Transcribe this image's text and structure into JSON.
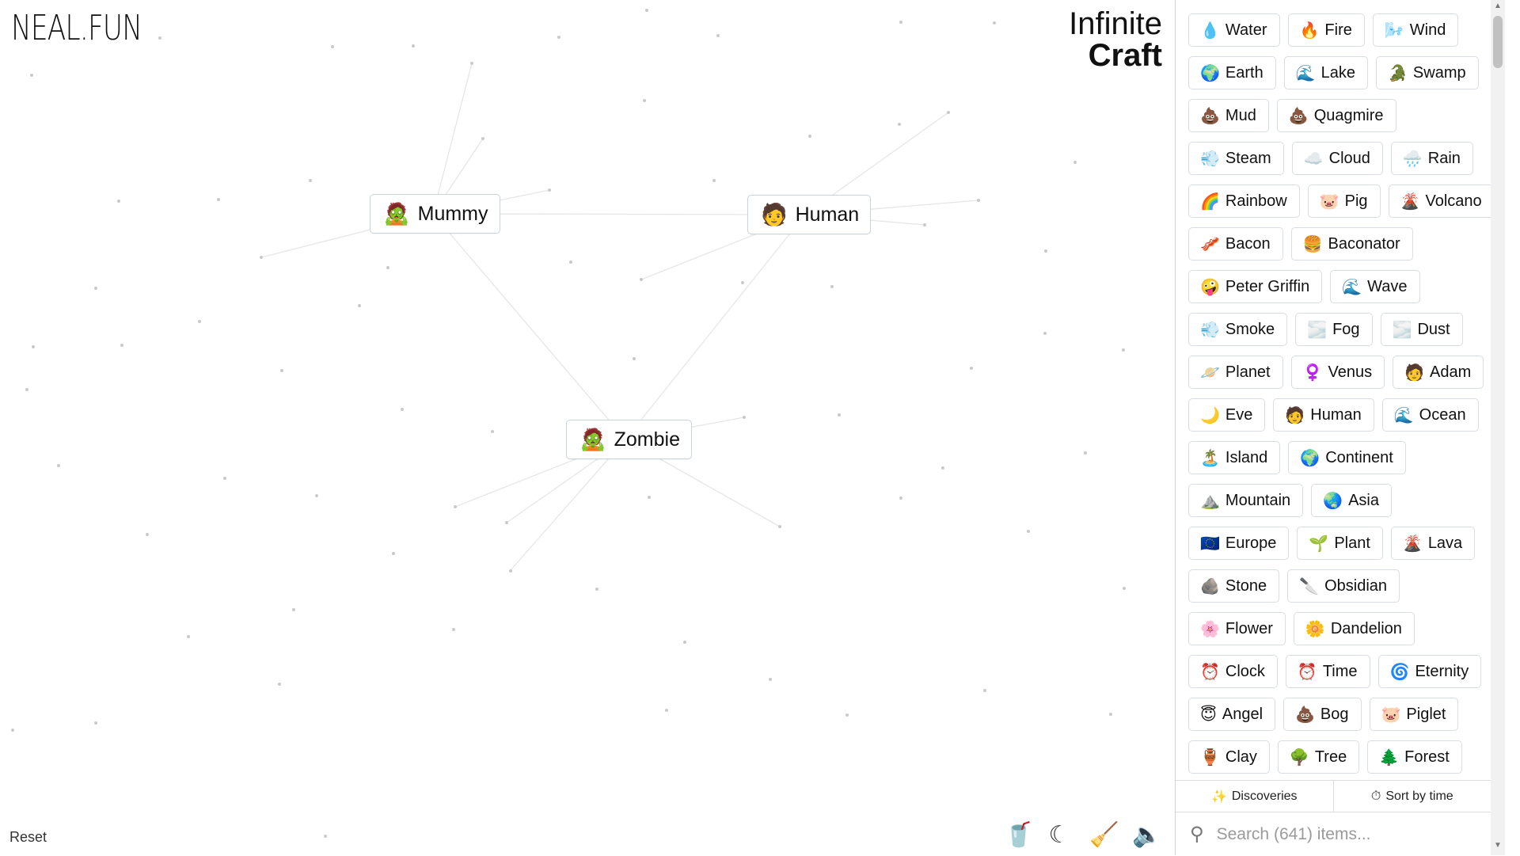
{
  "app": {
    "logo": "NEAL.FUN",
    "title_line1": "Infinite",
    "title_line2": "Craft",
    "reset_label": "Reset"
  },
  "canvas_tiles": [
    {
      "emoji": "🧟",
      "label": "Mummy"
    },
    {
      "emoji": "🧑",
      "label": "Human"
    },
    {
      "emoji": "🧟",
      "label": "Zombie"
    }
  ],
  "toolbar_icons": [
    "cup-icon",
    "moon-icon",
    "broom-icon",
    "speaker-icon"
  ],
  "sidebar": {
    "items": [
      {
        "emoji": "💧",
        "label": "Water"
      },
      {
        "emoji": "🔥",
        "label": "Fire"
      },
      {
        "emoji": "🌬️",
        "label": "Wind"
      },
      {
        "emoji": "🌍",
        "label": "Earth"
      },
      {
        "emoji": "🌊",
        "label": "Lake"
      },
      {
        "emoji": "🐊",
        "label": "Swamp"
      },
      {
        "emoji": "💩",
        "label": "Mud"
      },
      {
        "emoji": "💩",
        "label": "Quagmire"
      },
      {
        "emoji": "💨",
        "label": "Steam"
      },
      {
        "emoji": "☁️",
        "label": "Cloud"
      },
      {
        "emoji": "🌧️",
        "label": "Rain"
      },
      {
        "emoji": "🌈",
        "label": "Rainbow"
      },
      {
        "emoji": "🐷",
        "label": "Pig"
      },
      {
        "emoji": "🌋",
        "label": "Volcano"
      },
      {
        "emoji": "🥓",
        "label": "Bacon"
      },
      {
        "emoji": "🍔",
        "label": "Baconator"
      },
      {
        "emoji": "🤪",
        "label": "Peter Griffin"
      },
      {
        "emoji": "🌊",
        "label": "Wave"
      },
      {
        "emoji": "💨",
        "label": "Smoke"
      },
      {
        "emoji": "🌫️",
        "label": "Fog"
      },
      {
        "emoji": "🌫️",
        "label": "Dust"
      },
      {
        "emoji": "🪐",
        "label": "Planet"
      },
      {
        "emoji": "♀️",
        "label": "Venus"
      },
      {
        "emoji": "🧑",
        "label": "Adam"
      },
      {
        "emoji": "🌙",
        "label": "Eve"
      },
      {
        "emoji": "🧑",
        "label": "Human"
      },
      {
        "emoji": "🌊",
        "label": "Ocean"
      },
      {
        "emoji": "🏝️",
        "label": "Island"
      },
      {
        "emoji": "🌍",
        "label": "Continent"
      },
      {
        "emoji": "⛰️",
        "label": "Mountain"
      },
      {
        "emoji": "🌏",
        "label": "Asia"
      },
      {
        "emoji": "🇪🇺",
        "label": "Europe"
      },
      {
        "emoji": "🌱",
        "label": "Plant"
      },
      {
        "emoji": "🌋",
        "label": "Lava"
      },
      {
        "emoji": "🪨",
        "label": "Stone"
      },
      {
        "emoji": "🔪",
        "label": "Obsidian"
      },
      {
        "emoji": "🌸",
        "label": "Flower"
      },
      {
        "emoji": "🌼",
        "label": "Dandelion"
      },
      {
        "emoji": "⏰",
        "label": "Clock"
      },
      {
        "emoji": "⏰",
        "label": "Time"
      },
      {
        "emoji": "🌀",
        "label": "Eternity"
      },
      {
        "emoji": "😇",
        "label": "Angel"
      },
      {
        "emoji": "💩",
        "label": "Bog"
      },
      {
        "emoji": "🐷",
        "label": "Piglet"
      },
      {
        "emoji": "🏺",
        "label": "Clay"
      },
      {
        "emoji": "🌳",
        "label": "Tree"
      },
      {
        "emoji": "🌲",
        "label": "Forest"
      }
    ],
    "tabs": [
      {
        "icon": "✨",
        "label": "Discoveries"
      },
      {
        "icon": "⏱",
        "label": "Sort by time"
      }
    ],
    "search_placeholder": "Search (641) items..."
  }
}
